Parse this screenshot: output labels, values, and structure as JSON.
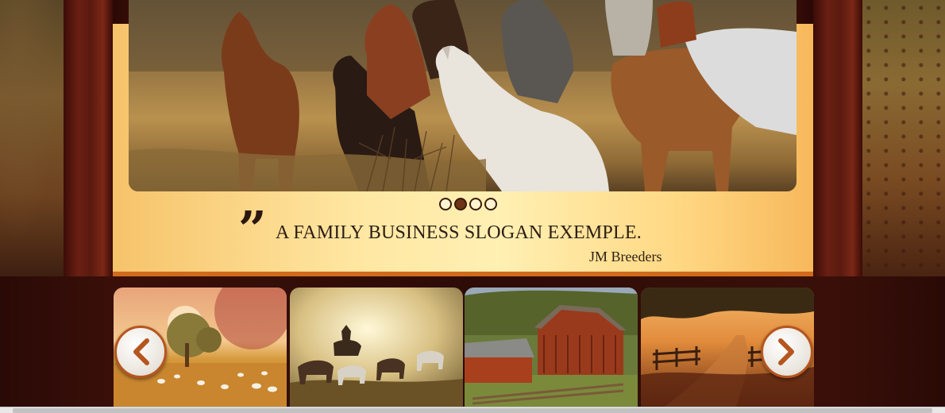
{
  "slider": {
    "active_dot": 2,
    "dots": [
      1,
      2,
      3,
      4
    ]
  },
  "slogan": {
    "quote_mark": "”",
    "text": "A FAMILY BUSINESS SLOGAN EXEMPLE.",
    "author": "JM Breeders"
  },
  "gallery": {
    "prev_icon": "chevron-left-icon",
    "next_icon": "chevron-right-icon",
    "thumbnails": [
      "sunset-sheep-field",
      "cowboy-herding-horses",
      "red-barn",
      "ranch-fence-path"
    ]
  },
  "colors": {
    "banner": "#ffe7a2",
    "accent": "#b5561f",
    "wood": "#5c1b10"
  }
}
